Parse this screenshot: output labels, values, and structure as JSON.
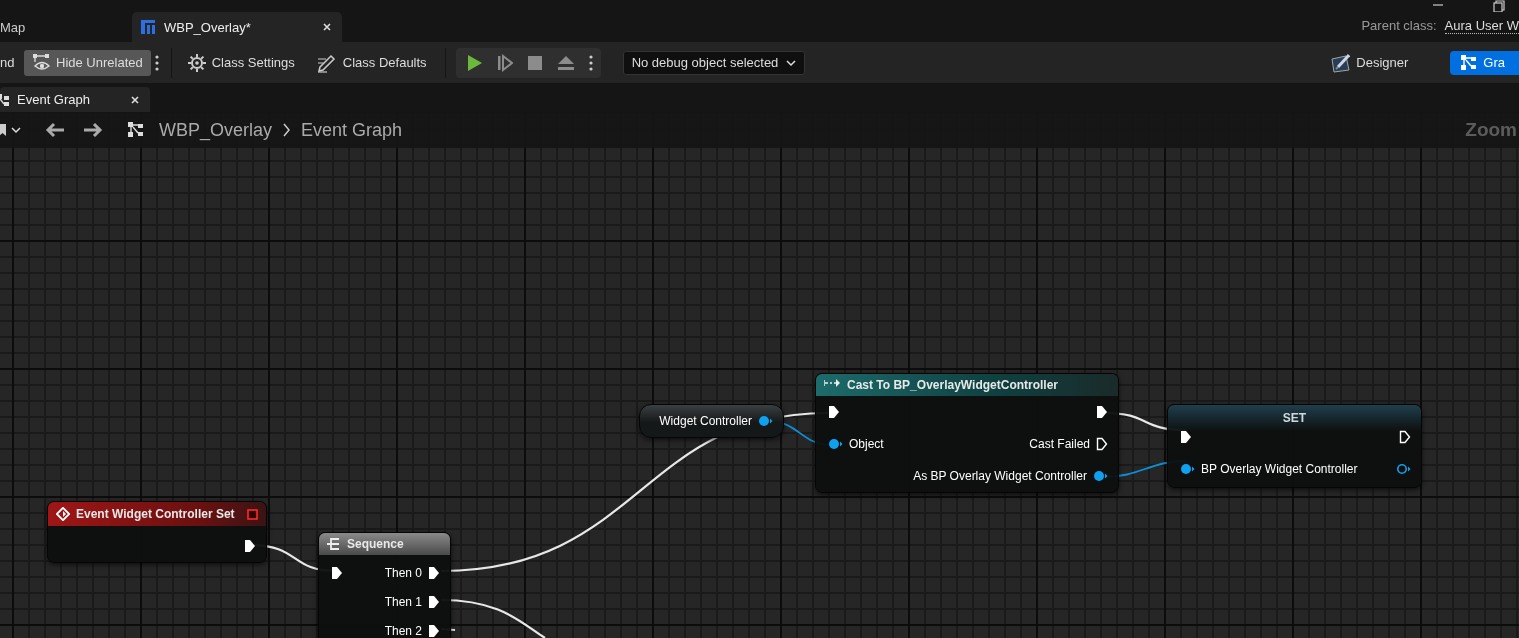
{
  "document_tabs": [
    {
      "label": "Map",
      "selected": false
    },
    {
      "label": "WBP_Overlay*",
      "selected": true
    }
  ],
  "parent_class": {
    "label": "Parent class:",
    "value": "Aura User W"
  },
  "toolbar": {
    "find_fragment": "nd",
    "hide_unrelated": {
      "label": "Hide Unrelated",
      "on": true
    },
    "class_settings": "Class Settings",
    "class_defaults": "Class Defaults",
    "debug_object": "No debug object selected"
  },
  "modes": [
    {
      "label": "Designer",
      "selected": false
    },
    {
      "label": "Gra",
      "selected": true
    }
  ],
  "graph_tabs": [
    {
      "label": "Event Graph",
      "selected": true
    }
  ],
  "breadcrumb": [
    "WBP_Overlay",
    "Event Graph"
  ],
  "zoom_label": "Zoom",
  "nodes": [
    {
      "kind": "variable",
      "rows": [
        {
          "out": {
            "kind": "object",
            "label": "Widget Controller",
            "connected": true
          }
        }
      ]
    },
    {
      "kind": "cast",
      "title": "Cast To BP_OverlayWidgetController",
      "rows": [
        {
          "in": {
            "kind": "exec",
            "connected": true
          },
          "out": {
            "kind": "exec",
            "connected": true
          }
        },
        {
          "in": {
            "kind": "object",
            "label": "Object",
            "connected": true
          },
          "out": {
            "kind": "exec",
            "label": "Cast Failed",
            "connected": false
          }
        },
        {
          "out": {
            "kind": "object",
            "label": "As BP Overlay Widget Controller",
            "connected": true
          }
        }
      ]
    },
    {
      "kind": "set",
      "title": "SET",
      "rows": [
        {
          "in": {
            "kind": "exec",
            "connected": true
          },
          "out": {
            "kind": "exec",
            "connected": false
          }
        },
        {
          "in": {
            "kind": "object",
            "label": "BP Overlay Widget Controller",
            "connected": true
          },
          "out": {
            "kind": "object",
            "connected": false
          }
        }
      ]
    },
    {
      "kind": "event",
      "title": "Event Widget Controller Set",
      "rows": [
        {
          "out": {
            "kind": "exec",
            "connected": true
          }
        }
      ]
    },
    {
      "kind": "sequence",
      "title": "Sequence",
      "rows": [
        {
          "in": {
            "kind": "exec",
            "connected": true
          },
          "out": {
            "kind": "exec",
            "label": "Then 0",
            "connected": true
          }
        },
        {
          "out": {
            "kind": "exec",
            "label": "Then 1",
            "connected": true
          }
        },
        {
          "out": {
            "kind": "exec",
            "label": "Then 2",
            "connected": true
          }
        }
      ]
    }
  ]
}
